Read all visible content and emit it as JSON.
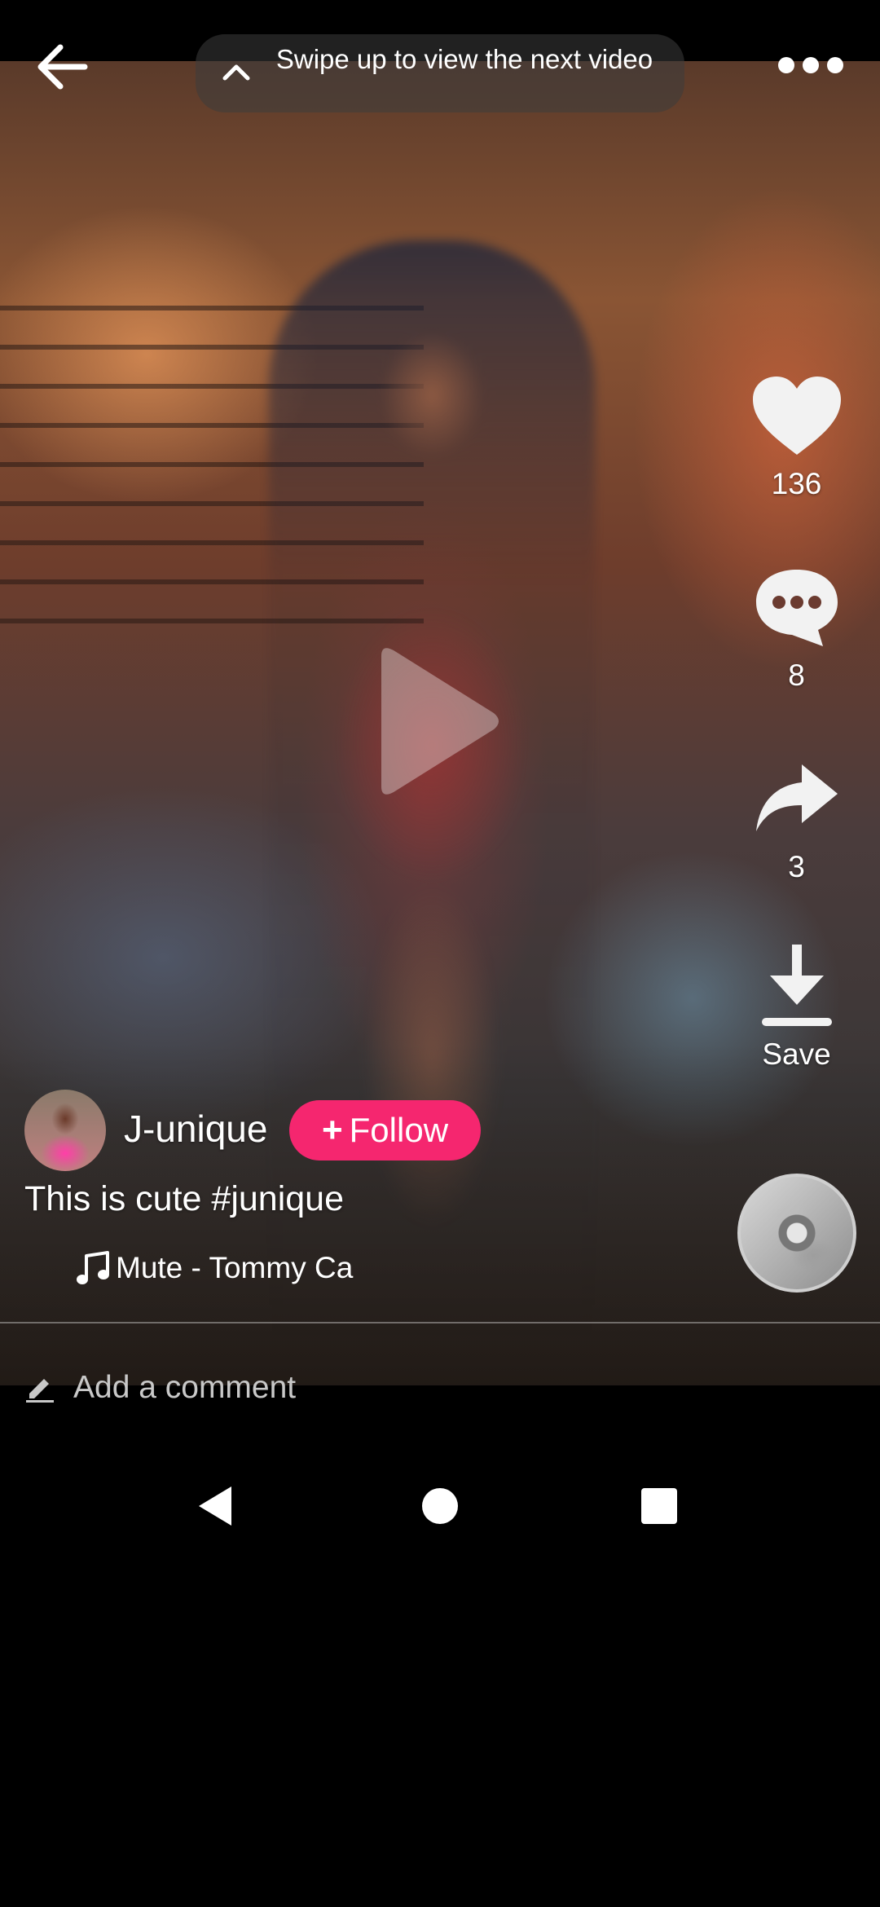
{
  "top_bar": {
    "swipe_hint": "Swipe up to view the next video"
  },
  "actions": {
    "like_count": "136",
    "comment_count": "8",
    "share_count": "3",
    "save_label": "Save"
  },
  "author": {
    "username": "J-unique",
    "follow_label": "Follow"
  },
  "caption": "This is cute #junique",
  "music": {
    "track": "Mute - Tommy Ca"
  },
  "comment_input": {
    "placeholder": "Add a comment"
  },
  "colors": {
    "follow_button": "#f5266f",
    "background": "#000000"
  },
  "icons": [
    "back-arrow-icon",
    "chevron-up-icon",
    "more-icon",
    "play-icon",
    "heart-icon",
    "comment-bubble-icon",
    "share-arrow-icon",
    "download-icon",
    "music-note-icon",
    "pencil-icon",
    "nav-back-icon",
    "nav-home-icon",
    "nav-recents-icon"
  ]
}
